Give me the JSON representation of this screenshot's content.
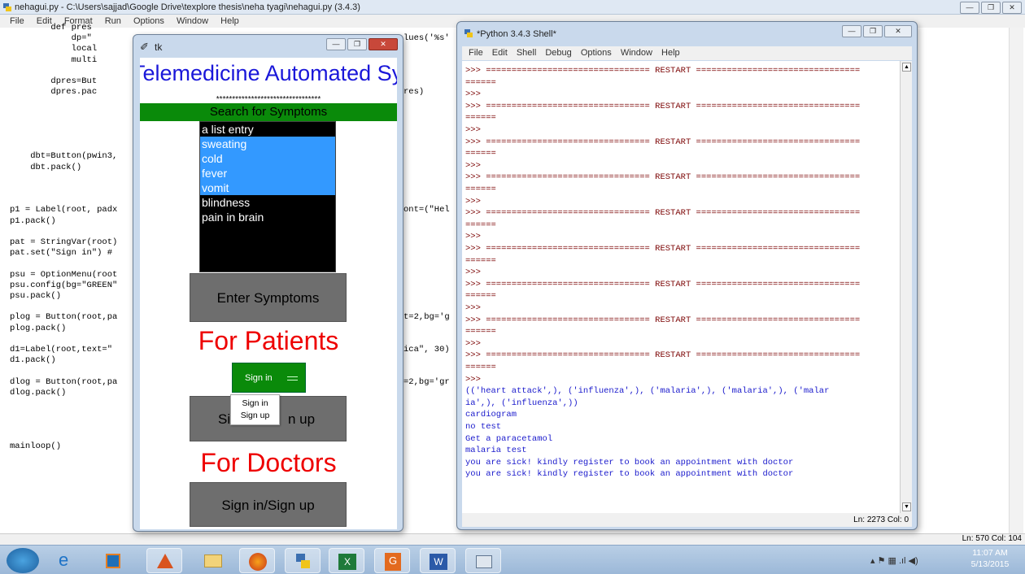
{
  "editor": {
    "title": "nehagui.py - C:\\Users\\sajjad\\Google Drive\\texplore thesis\\neha tyagi\\nehagui.py (3.4.3)",
    "menu": [
      "File",
      "Edit",
      "Format",
      "Run",
      "Options",
      "Window",
      "Help"
    ],
    "status": "Ln: 570 Col: 104",
    "code_left": [
      "        def pres",
      "            dp=\"",
      "            local",
      "            multi",
      "",
      "        dpres=But",
      "        dpres.pac",
      "",
      "",
      "",
      "",
      "",
      "    dbt=Button(pwin3,",
      "    dbt.pack()",
      "",
      "",
      "",
      "p1 = Label(root, padx",
      "p1.pack()",
      "",
      "pat = StringVar(root)",
      "pat.set(\"Sign in\") #",
      "",
      "psu = OptionMenu(root",
      "psu.config(bg=\"GREEN\"",
      "psu.pack()",
      "",
      "plog = Button(root,pa",
      "plog.pack()",
      "",
      "d1=Label(root,text=\"",
      "d1.pack()",
      "",
      "dlog = Button(root,pa",
      "dlog.pack()",
      "",
      "",
      "",
      "",
      "mainloop()"
    ],
    "code_right": [
      {
        "text": "lues('%s'",
        "row": 1
      },
      {
        "text": "res)",
        "row": 6
      },
      {
        "text": "ont=(\"Hel",
        "row": 17
      },
      {
        "text": "t=2,bg='g",
        "row": 27
      },
      {
        "text": "ica\", 30)",
        "row": 30
      },
      {
        "text": "=2,bg='gr",
        "row": 33
      }
    ]
  },
  "tk": {
    "title": "tk",
    "app_title": "Telemedicine Automated Syste",
    "stars": "*********************************",
    "search_label": "Search for Symptoms",
    "list_items": [
      {
        "label": "a list entry",
        "selected": false
      },
      {
        "label": "sweating",
        "selected": true
      },
      {
        "label": "cold",
        "selected": true
      },
      {
        "label": "fever",
        "selected": true
      },
      {
        "label": "vomit",
        "selected": true
      },
      {
        "label": "blindness",
        "selected": false
      },
      {
        "label": "pain in brain",
        "selected": false
      }
    ],
    "enter_button": "Enter Symptoms",
    "patients_label": "For Patients",
    "option_value": "Sign in",
    "dropdown": [
      "Sign in",
      "Sign up"
    ],
    "signup_left": "Si",
    "signup_right": "n up",
    "doctors_label": "For Doctors",
    "doctor_button": "Sign in/Sign up"
  },
  "shell": {
    "title": "*Python 3.4.3 Shell*",
    "menu": [
      "File",
      "Edit",
      "Shell",
      "Debug",
      "Options",
      "Window",
      "Help"
    ],
    "restart_line": ">>> ================================ RESTART ================================",
    "restart_tail": "======",
    "prompt": ">>>",
    "output": [
      "(('heart attack',), ('influenza',), ('malaria',), ('malaria',), ('malar",
      "ia',), ('influenza',))",
      "cardiogram",
      "no test",
      "Get a paracetamol",
      "malaria test",
      "you are sick! kindly register to book an appointment with doctor",
      "you are sick! kindly register to book an appointment with doctor"
    ],
    "status": "Ln: 2273 Col: 0"
  },
  "taskbar": {
    "time": "11:07 AM",
    "date": "5/13/2015",
    "apps": [
      "start",
      "internet-explorer",
      "outlook",
      "matlab",
      "file-explorer",
      "firefox",
      "python",
      "excel",
      "pdf",
      "word",
      "window"
    ]
  }
}
